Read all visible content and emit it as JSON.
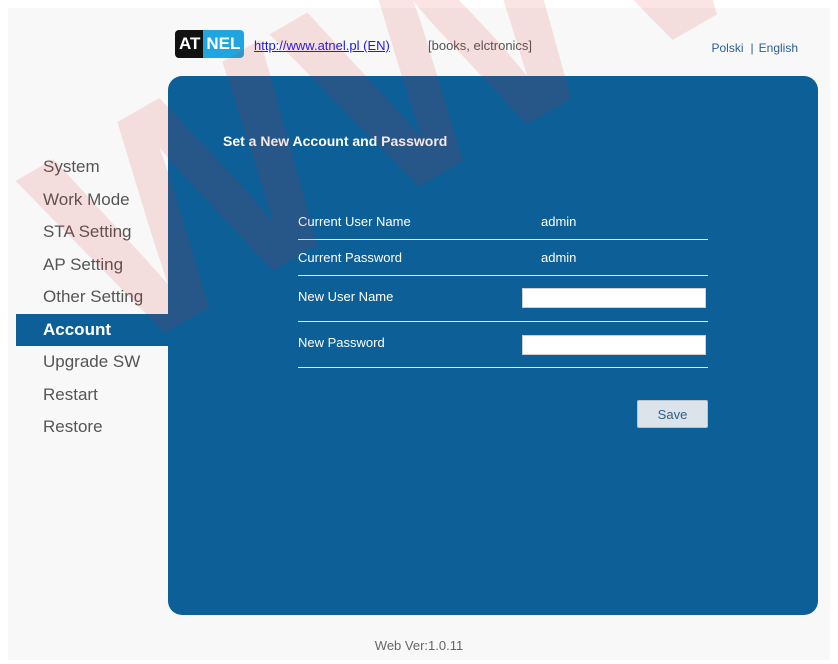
{
  "header": {
    "logo_left": "AT",
    "logo_right": "NEL",
    "link_text": "http://www.atnel.pl (EN)",
    "note": "[books, elctronics]",
    "languages": [
      "Polski",
      "English"
    ],
    "lang_separator": "|"
  },
  "sidebar": {
    "items": [
      {
        "label": "System",
        "active": false
      },
      {
        "label": "Work Mode",
        "active": false
      },
      {
        "label": "STA Setting",
        "active": false
      },
      {
        "label": "AP Setting",
        "active": false
      },
      {
        "label": "Other Setting",
        "active": false
      },
      {
        "label": "Account",
        "active": true
      },
      {
        "label": "Upgrade SW",
        "active": false
      },
      {
        "label": "Restart",
        "active": false
      },
      {
        "label": "Restore",
        "active": false
      }
    ]
  },
  "panel": {
    "title": "Set a New Account and Password",
    "current_user_label": "Current User Name",
    "current_user_value": "admin",
    "current_password_label": "Current Password",
    "current_password_value": "admin",
    "new_user_label": "New User Name",
    "new_user_value": "",
    "new_password_label": "New Password",
    "new_password_value": "",
    "save_label": "Save"
  },
  "footer": {
    "version": "Web Ver:1.0.11"
  },
  "colors": {
    "panel_bg": "#0d5f97",
    "active_item_bg": "#0d5f97",
    "link": "#1a1aee"
  }
}
